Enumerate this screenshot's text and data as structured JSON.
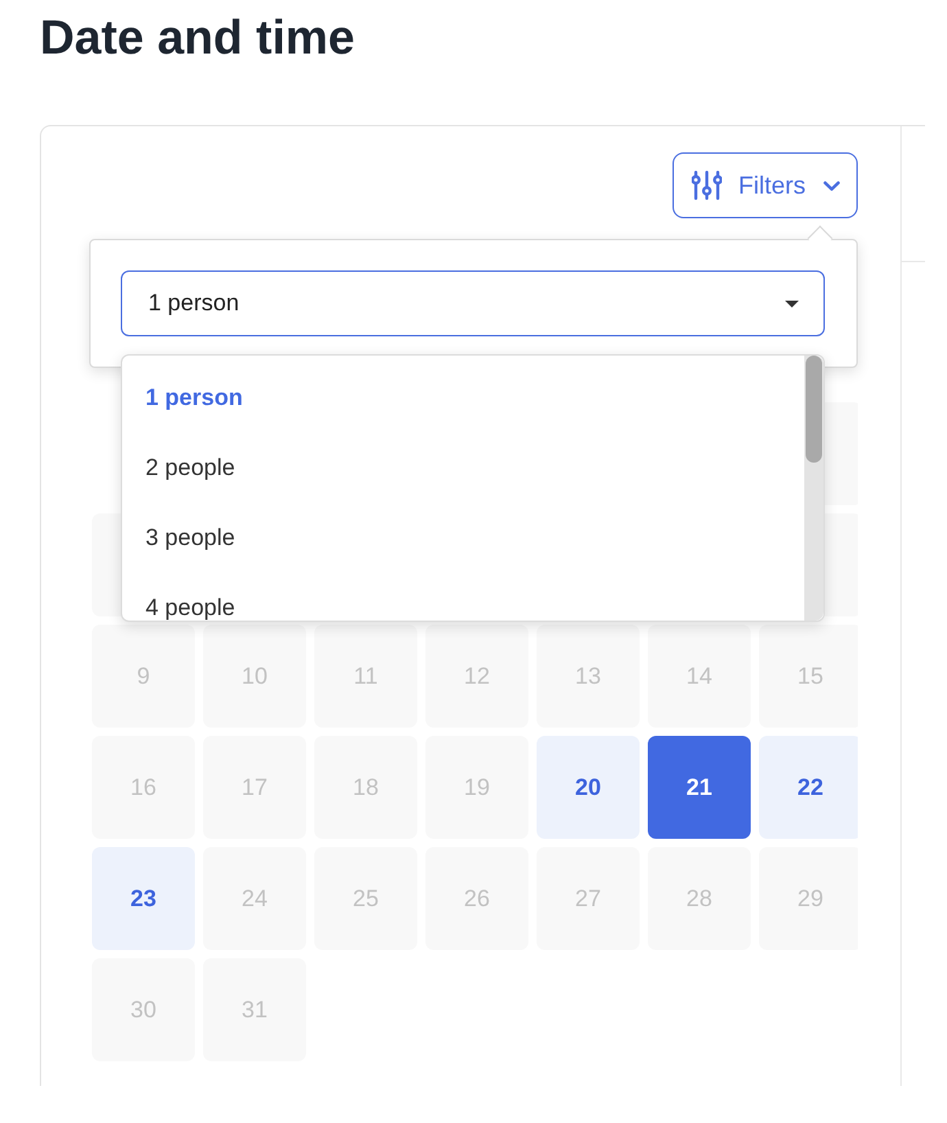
{
  "page": {
    "title": "Date and time"
  },
  "filters_button": {
    "label": "Filters",
    "expanded": true
  },
  "party_size": {
    "select": {
      "value": "1 person",
      "open": true
    },
    "options": [
      {
        "label": "1 person",
        "selected": true
      },
      {
        "label": "2 people",
        "selected": false
      },
      {
        "label": "3 people",
        "selected": false
      },
      {
        "label": "4 people",
        "selected": false
      }
    ]
  },
  "calendar": {
    "weeks": [
      {
        "days": [
          {
            "kind": "blank"
          },
          {
            "kind": "blank"
          },
          {
            "kind": "blank"
          },
          {
            "kind": "blank"
          },
          {
            "kind": "blank"
          },
          {
            "kind": "blank"
          },
          {
            "kind": "covered"
          }
        ]
      },
      {
        "days": [
          {
            "kind": "covered"
          },
          {
            "kind": "blank"
          },
          {
            "kind": "blank"
          },
          {
            "kind": "blank"
          },
          {
            "kind": "blank"
          },
          {
            "kind": "blank"
          },
          {
            "kind": "covered"
          }
        ]
      },
      {
        "days": [
          {
            "kind": "day",
            "label": "9",
            "available": false,
            "selected": false
          },
          {
            "kind": "day",
            "label": "10",
            "available": false,
            "selected": false
          },
          {
            "kind": "day",
            "label": "11",
            "available": false,
            "selected": false
          },
          {
            "kind": "day",
            "label": "12",
            "available": false,
            "selected": false
          },
          {
            "kind": "day",
            "label": "13",
            "available": false,
            "selected": false
          },
          {
            "kind": "day",
            "label": "14",
            "available": false,
            "selected": false
          },
          {
            "kind": "day",
            "label": "15",
            "available": false,
            "selected": false
          }
        ]
      },
      {
        "days": [
          {
            "kind": "day",
            "label": "16",
            "available": false,
            "selected": false
          },
          {
            "kind": "day",
            "label": "17",
            "available": false,
            "selected": false
          },
          {
            "kind": "day",
            "label": "18",
            "available": false,
            "selected": false
          },
          {
            "kind": "day",
            "label": "19",
            "available": false,
            "selected": false
          },
          {
            "kind": "day",
            "label": "20",
            "available": true,
            "selected": false
          },
          {
            "kind": "day",
            "label": "21",
            "available": true,
            "selected": true
          },
          {
            "kind": "day",
            "label": "22",
            "available": true,
            "selected": false
          }
        ]
      },
      {
        "days": [
          {
            "kind": "day",
            "label": "23",
            "available": true,
            "selected": false
          },
          {
            "kind": "day",
            "label": "24",
            "available": false,
            "selected": false
          },
          {
            "kind": "day",
            "label": "25",
            "available": false,
            "selected": false
          },
          {
            "kind": "day",
            "label": "26",
            "available": false,
            "selected": false
          },
          {
            "kind": "day",
            "label": "27",
            "available": false,
            "selected": false
          },
          {
            "kind": "day",
            "label": "28",
            "available": false,
            "selected": false
          },
          {
            "kind": "day",
            "label": "29",
            "available": false,
            "selected": false
          }
        ]
      },
      {
        "days": [
          {
            "kind": "day",
            "label": "30",
            "available": false,
            "selected": false
          },
          {
            "kind": "day",
            "label": "31",
            "available": false,
            "selected": false
          }
        ]
      }
    ]
  }
}
